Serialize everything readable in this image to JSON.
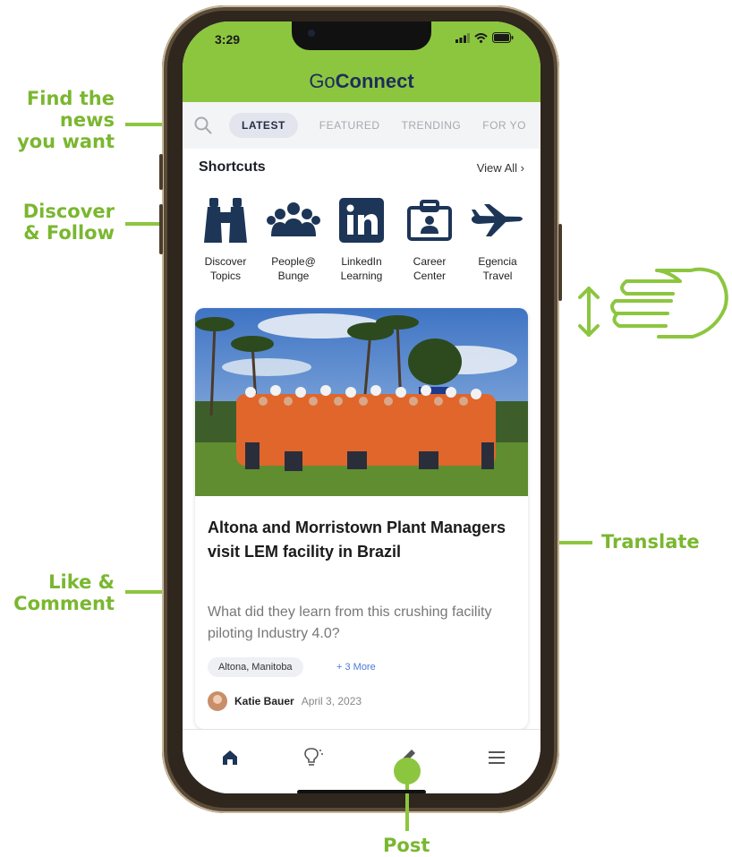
{
  "callouts": {
    "find_news": "Find the\nnews\nyou want",
    "discover": "Discover\n& Follow",
    "like_comment": "Like &\nComment",
    "translate": "Translate",
    "post": "Post"
  },
  "status_bar": {
    "time": "3:29"
  },
  "app": {
    "title_prefix": "Go",
    "title_bold": "Connect"
  },
  "tabs": [
    "LATEST",
    "FEATURED",
    "TRENDING",
    "FOR YO"
  ],
  "active_tab": "LATEST",
  "shortcuts": {
    "heading": "Shortcuts",
    "view_all": "View All",
    "items": [
      {
        "label": "Discover\nTopics",
        "icon": "binoculars-icon"
      },
      {
        "label": "People@\nBunge",
        "icon": "people-icon"
      },
      {
        "label": "LinkedIn\nLearning",
        "icon": "linkedin-icon"
      },
      {
        "label": "Career\nCenter",
        "icon": "badge-icon"
      },
      {
        "label": "Egencia\nTravel",
        "icon": "airplane-icon"
      }
    ]
  },
  "article": {
    "title": "Altona and Morristown Plant Managers visit LEM facility in Brazil",
    "subtitle": "What did they learn from this crushing facility piloting Industry 4.0?",
    "tag": "Altona, Manitoba",
    "more_tags": "+ 3 More",
    "author": "Katie Bauer",
    "date": "April 3, 2023"
  },
  "bottom_nav": [
    "home-icon",
    "lightbulb-icon",
    "pencil-icon",
    "menu-icon"
  ],
  "colors": {
    "accent_green": "#8cc63f",
    "callout_green": "#7ab730",
    "title_navy": "#1d2d5c",
    "icon_navy": "#1d3557"
  }
}
